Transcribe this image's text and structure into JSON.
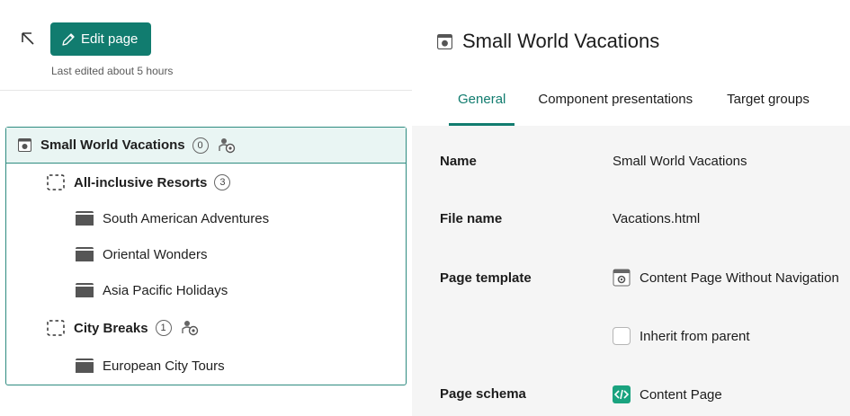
{
  "left": {
    "edit_label": "Edit page",
    "last_edited": "Last edited about 5 hours"
  },
  "tree": {
    "root": {
      "label": "Small World Vacations",
      "count": "0"
    },
    "groups": [
      {
        "label": "All-inclusive Resorts",
        "count": "3",
        "items": [
          "South American Adventures",
          "Oriental Wonders",
          "Asia Pacific Holidays"
        ]
      },
      {
        "label": "City Breaks",
        "count": "1",
        "items": [
          "European City Tours"
        ]
      }
    ]
  },
  "right": {
    "title": "Small World Vacations",
    "tabs": [
      "General",
      "Component presentations",
      "Target groups"
    ],
    "active_tab": "General",
    "fields": {
      "name_label": "Name",
      "name_value": "Small World Vacations",
      "file_label": "File name",
      "file_value": "Vacations.html",
      "template_label": "Page template",
      "template_value": "Content Page Without Navigation",
      "inherit_label": "Inherit from parent",
      "schema_label": "Page schema",
      "schema_value": "Content Page"
    }
  },
  "colors": {
    "accent": "#117c6f",
    "tree_border": "#2e8b80",
    "root_bg": "#e9f5f3",
    "form_bg": "#f5f5f5"
  }
}
